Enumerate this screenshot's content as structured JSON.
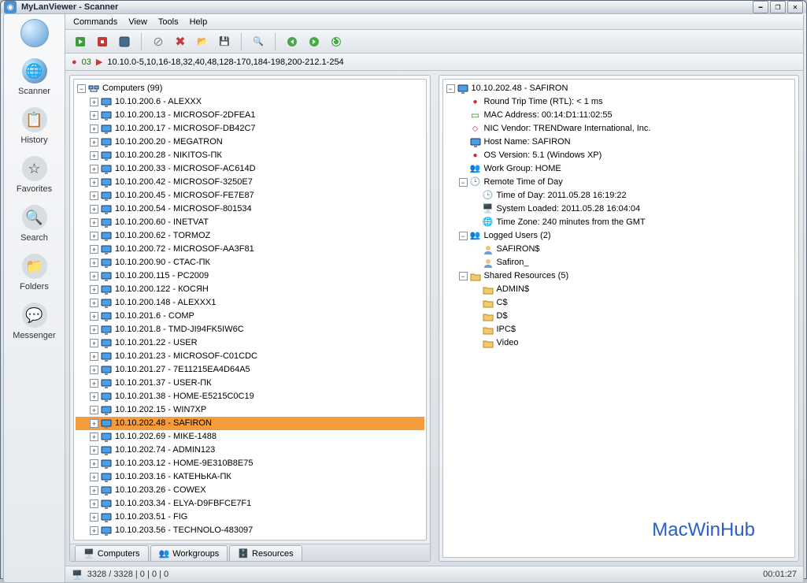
{
  "window_title": "MyLanViewer - Scanner",
  "menu": {
    "commands": "Commands",
    "view": "View",
    "tools": "Tools",
    "help": "Help"
  },
  "sidebar": [
    {
      "label": "Scanner"
    },
    {
      "label": "History"
    },
    {
      "label": "Favorites"
    },
    {
      "label": "Search"
    },
    {
      "label": "Folders"
    },
    {
      "label": "Messenger"
    }
  ],
  "address_count": "03",
  "address_range": "10.10.0-5,10,16-18,32,40,48,128-170,184-198,200-212.1-254",
  "left_root_label": "Computers (99)",
  "computers": [
    "10.10.200.6 - ALEXXX",
    "10.10.200.13 - MICROSOF-2DFEA1",
    "10.10.200.17 - MICROSOF-DB42C7",
    "10.10.200.20 - MEGATRON",
    "10.10.200.28 - NIKITOS-ПК",
    "10.10.200.33 - MICROSOF-AC614D",
    "10.10.200.42 - MICROSOF-3250E7",
    "10.10.200.45 - MICROSOF-FE7E87",
    "10.10.200.54 - MICROSOF-801534",
    "10.10.200.60 - INETVAT",
    "10.10.200.62 - TORMOZ",
    "10.10.200.72 - MICROSOF-AA3F81",
    "10.10.200.90 - СТАС-ПК",
    "10.10.200.115 - PC2009",
    "10.10.200.122 - КОСЯН",
    "10.10.200.148 - ALEXXX1",
    "10.10.201.6 - COMP",
    "10.10.201.8 - TMD-JI94FK5IW6C",
    "10.10.201.22 - USER",
    "10.10.201.23 - MICROSOF-C01CDC",
    "10.10.201.27 - 7E11215EA4D64A5",
    "10.10.201.37 - USER-ПК",
    "10.10.201.38 - HOME-E5215C0C19",
    "10.10.202.15 - WIN7XP",
    "10.10.202.48 - SAFIRON",
    "10.10.202.69 - MIKE-1488",
    "10.10.202.74 - ADMIN123",
    "10.10.203.12 - HOME-9E310B8E75",
    "10.10.203.16 - КАТЕНЬКА-ПК",
    "10.10.203.26 - COWEX",
    "10.10.203.34 - ELYA-D9FBFCE7F1",
    "10.10.203.51 - FIG",
    "10.10.203.56 - TECHNOLO-483097"
  ],
  "selected_index": 24,
  "tabs": {
    "computers": "Computers",
    "workgroups": "Workgroups",
    "resources": "Resources"
  },
  "right_panel": {
    "host_header": "10.10.202.48 - SAFIRON",
    "rtt": "Round Trip Time (RTL): < 1 ms",
    "mac": "MAC Address: 00:14:D1:11:02:55",
    "nic": "NIC Vendor: TRENDware International, Inc.",
    "hostname": "Host Name: SAFIRON",
    "os": "OS Version: 5.1 (Windows XP)",
    "workgroup": "Work Group: HOME",
    "remote_time_hdr": "Remote Time of Day",
    "time_of_day": "Time of Day: 2011.05.28  16:19:22",
    "system_loaded": "System Loaded: 2011.05.28  16:04:04",
    "timezone": "Time Zone: 240 minutes from the GMT",
    "logged_users_hdr": "Logged Users (2)",
    "users": [
      "SAFIRON$",
      "Safiron_"
    ],
    "shared_hdr": "Shared Resources (5)",
    "shares": [
      "ADMIN$",
      "C$",
      "D$",
      "IPC$",
      "Video"
    ]
  },
  "statusbar": {
    "left": "3328 / 3328  |  0  |  0  |  0",
    "right": "00:01:27"
  },
  "watermark": "MacWinHub"
}
